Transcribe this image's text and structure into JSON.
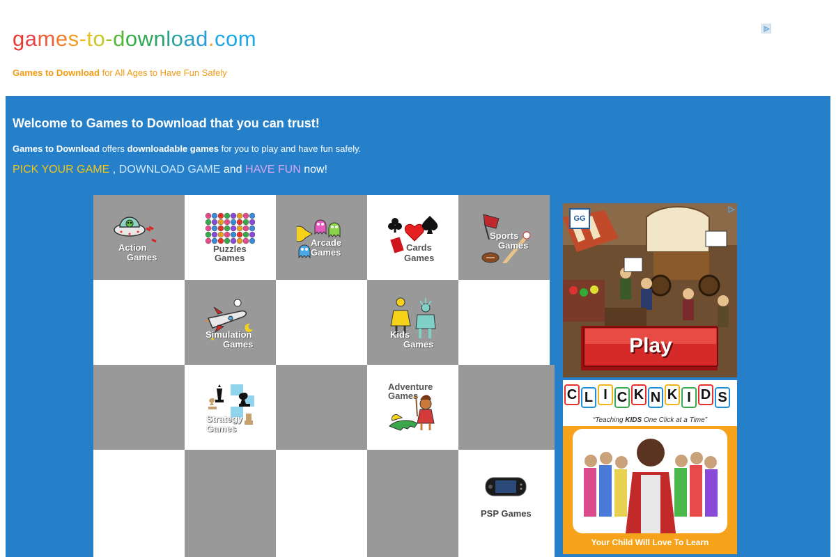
{
  "header": {
    "logo_parts": [
      {
        "text": "g",
        "color": "#e63a2e"
      },
      {
        "text": "a",
        "color": "#e8434a"
      },
      {
        "text": "m",
        "color": "#ec5d3a"
      },
      {
        "text": "e",
        "color": "#f07d2c"
      },
      {
        "text": "s",
        "color": "#f49b1f"
      },
      {
        "text": "-",
        "color": "#f5b21a"
      },
      {
        "text": "t",
        "color": "#e7c21a"
      },
      {
        "text": "o",
        "color": "#c5c722"
      },
      {
        "text": "-",
        "color": "#9cc42a"
      },
      {
        "text": "d",
        "color": "#57b53b"
      },
      {
        "text": "o",
        "color": "#3aae46"
      },
      {
        "text": "w",
        "color": "#2ea853"
      },
      {
        "text": "n",
        "color": "#2ca46b"
      },
      {
        "text": "l",
        "color": "#29a287"
      },
      {
        "text": "o",
        "color": "#28a39d"
      },
      {
        "text": "a",
        "color": "#2a9fbd"
      },
      {
        "text": "d",
        "color": "#2d9ad6"
      },
      {
        "text": ".",
        "color": "#f0a020"
      },
      {
        "text": "c",
        "color": "#1ea6e8"
      },
      {
        "text": "o",
        "color": "#1ea6e8"
      },
      {
        "text": "m",
        "color": "#1ea6e8"
      }
    ],
    "tagline_bold": "Games to Download",
    "tagline_rest": " for All Ages to Have Fun Safely"
  },
  "main": {
    "welcome": "Welcome to Games to Download that you can trust!",
    "offers": {
      "b1": "Games to Download",
      "t1": " offers ",
      "b2": "downloadable games",
      "t2": " for you to play and have fun safely."
    },
    "pick": {
      "p1": "PICK YOUR GAME",
      "p1_color": "#f5c518",
      "sep1": " , ",
      "p2": "DOWNLOAD GAME",
      "p2_color": "#cde8ff",
      "sep2": " and ",
      "p3": "HAVE FUN",
      "p3_color": "#d9a6f5",
      "end": " now!"
    }
  },
  "games": {
    "action": {
      "l1": "Action",
      "l2": "Games",
      "icon": "alien-ufo-icon"
    },
    "puzzles": {
      "l1": "Puzzles",
      "l2": "Games",
      "icon": "bubbles-icon"
    },
    "arcade": {
      "l1": "Arcade",
      "l2": "Games",
      "icon": "pacman-icon"
    },
    "cards": {
      "l1": "Cards",
      "l2": "Games",
      "icon": "card-suits-icon"
    },
    "sports": {
      "l1": "Sports",
      "l2": "Games",
      "icon": "sports-icon"
    },
    "simulation": {
      "l1": "Simulation",
      "l2": "Games",
      "icon": "rocket-icon"
    },
    "kids": {
      "l1": "Kids",
      "l2": "Games",
      "icon": "kids-icon"
    },
    "strategy": {
      "l1": "Strategy",
      "l2": "Games",
      "icon": "chess-icon"
    },
    "adventure": {
      "l1": "Adventure",
      "l2": "Games",
      "icon": "crocodile-icon"
    },
    "psp": {
      "l1": "PSP Games",
      "icon": "psp-icon"
    }
  },
  "ads": {
    "ad1": {
      "brand": "GG",
      "button": "Play"
    },
    "ad2": {
      "title_letters": [
        "C",
        "L",
        "I",
        "C",
        "K",
        "N",
        "K",
        "I",
        "D",
        "S"
      ],
      "letter_colors": [
        "#e8312a",
        "#1e8fd6",
        "#f2b21b",
        "#3aa84a",
        "#e8312a",
        "#1e8fd6",
        "#f2b21b",
        "#3aa84a",
        "#e8312a",
        "#1e8fd6"
      ],
      "slogan_pre": "“Teaching ",
      "slogan_bold": "KIDS",
      "slogan_post": " One Click at a Time”",
      "footer": "Your Child Will Love To Learn"
    }
  }
}
